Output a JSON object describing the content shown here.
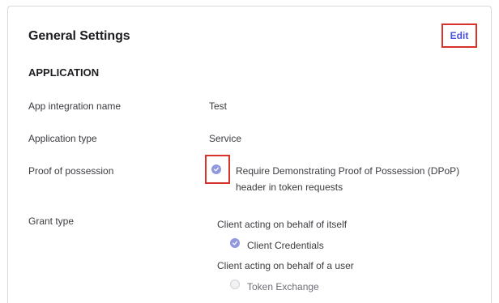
{
  "card": {
    "title": "General Settings",
    "edit_label": "Edit"
  },
  "application": {
    "section_title": "APPLICATION",
    "fields": [
      {
        "label": "App integration name",
        "value": "Test"
      },
      {
        "label": "Application type",
        "value": "Service"
      },
      {
        "label": "Proof of possession",
        "value": "Require Demonstrating Proof of Possession (DPoP) header in token requests"
      },
      {
        "label": "Grant type"
      }
    ]
  },
  "proof_of_possession": {
    "checked": true
  },
  "grant_type": {
    "groups": [
      {
        "title": "Client acting on behalf of itself",
        "options": [
          {
            "label": "Client Credentials",
            "checked": true
          }
        ]
      },
      {
        "title": "Client acting on behalf of a user",
        "options": [
          {
            "label": "Token Exchange",
            "checked": false
          }
        ]
      }
    ]
  },
  "colors": {
    "accent": "#4a52d8",
    "checkbox_checked": "#9198dd",
    "highlight_border": "#d9322b"
  }
}
